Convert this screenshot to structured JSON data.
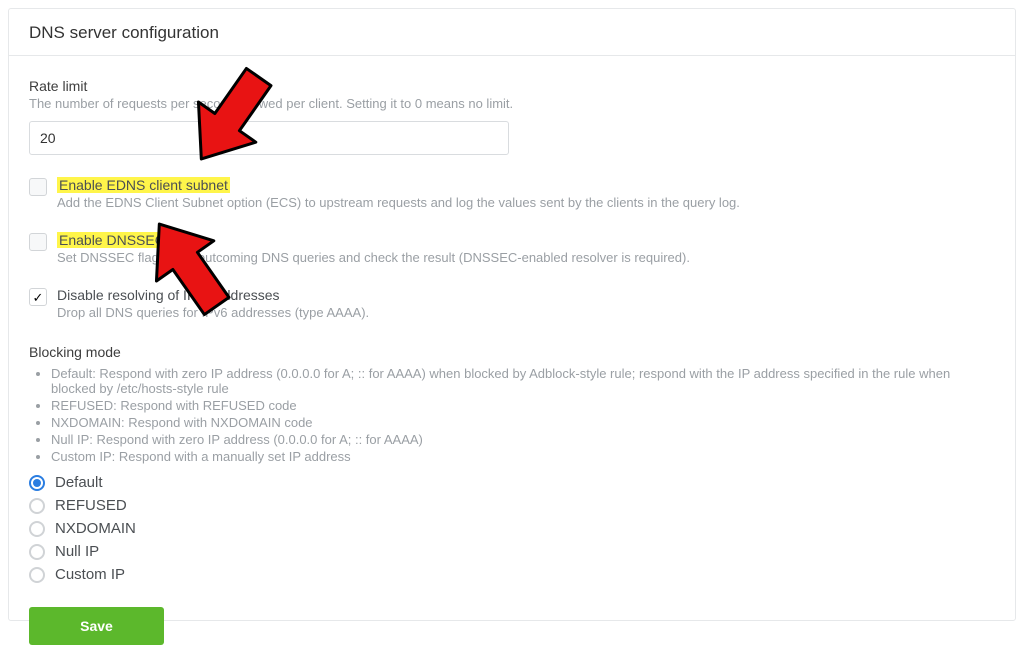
{
  "header": {
    "title": "DNS server configuration"
  },
  "rate_limit": {
    "label": "Rate limit",
    "help": "The number of requests per second allowed per client. Setting it to 0 means no limit.",
    "value": "20"
  },
  "options": [
    {
      "key": "edns",
      "label": "Enable EDNS client subnet",
      "desc": "Add the EDNS Client Subnet option (ECS) to upstream requests and log the values sent by the clients in the query log.",
      "checked": false,
      "highlight": true
    },
    {
      "key": "dnssec",
      "label": "Enable DNSSEC",
      "desc": "Set DNSSEC flag in the outcoming DNS queries and check the result (DNSSEC-enabled resolver is required).",
      "checked": false,
      "highlight": true
    },
    {
      "key": "ipv6",
      "label": "Disable resolving of IPv6 addresses",
      "desc": "Drop all DNS queries for IPv6 addresses (type AAAA).",
      "checked": true,
      "highlight": false
    }
  ],
  "blocking_mode": {
    "heading": "Blocking mode",
    "descriptions": [
      "Default: Respond with zero IP address (0.0.0.0 for A; :: for AAAA) when blocked by Adblock-style rule; respond with the IP address specified in the rule when blocked by /etc/hosts-style rule",
      "REFUSED: Respond with REFUSED code",
      "NXDOMAIN: Respond with NXDOMAIN code",
      "Null IP: Respond with zero IP address (0.0.0.0 for A; :: for AAAA)",
      "Custom IP: Respond with a manually set IP address"
    ],
    "choices": [
      "Default",
      "REFUSED",
      "NXDOMAIN",
      "Null IP",
      "Custom IP"
    ],
    "selected": "Default"
  },
  "actions": {
    "save": "Save"
  }
}
